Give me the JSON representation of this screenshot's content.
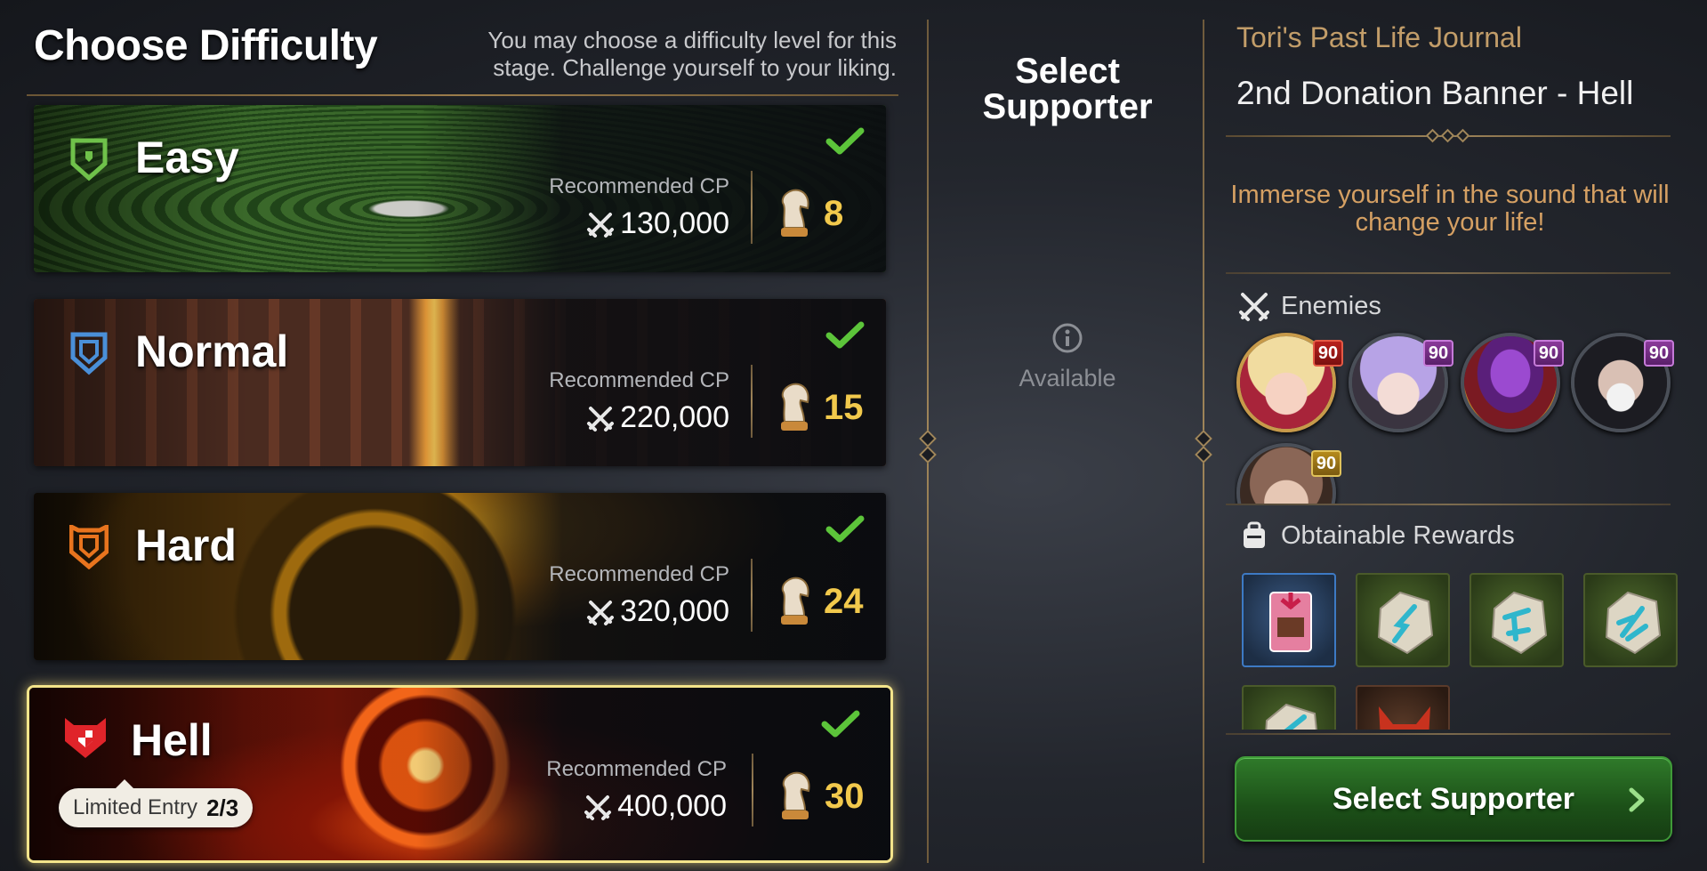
{
  "left": {
    "title": "Choose Difficulty",
    "description": "You may choose a difficulty level for this stage. Challenge yourself to your liking.",
    "difficulties": [
      {
        "name": "Easy",
        "rec_label": "Recommended CP",
        "cp": "130,000",
        "stamina": "8",
        "completed": true,
        "icon_color": "#6fc14a"
      },
      {
        "name": "Normal",
        "rec_label": "Recommended CP",
        "cp": "220,000",
        "stamina": "15",
        "completed": true,
        "icon_color": "#4a8fd8"
      },
      {
        "name": "Hard",
        "rec_label": "Recommended CP",
        "cp": "320,000",
        "stamina": "24",
        "completed": true,
        "icon_color": "#e8741e"
      },
      {
        "name": "Hell",
        "rec_label": "Recommended CP",
        "cp": "400,000",
        "stamina": "30",
        "completed": true,
        "icon_color": "#e0242a",
        "selected": true
      }
    ],
    "limited_entry": {
      "label": "Limited Entry",
      "count": "2/3"
    }
  },
  "middle": {
    "title_line1": "Select",
    "title_line2": "Supporter",
    "status": "Available"
  },
  "right": {
    "journal_title": "Tori's Past Life Journal",
    "stage_name": "2nd Donation Banner - Hell",
    "tagline": "Immerse yourself in the sound that will change your life!",
    "enemies_label": "Enemies",
    "enemies": [
      {
        "level": "90",
        "badge": "red"
      },
      {
        "level": "90",
        "badge": "purple"
      },
      {
        "level": "90",
        "badge": "purple"
      },
      {
        "level": "90",
        "badge": "purple"
      },
      {
        "level": "90",
        "badge": "gold"
      }
    ],
    "rewards_label": "Obtainable Rewards",
    "select_button": "Select Supporter"
  },
  "colors": {
    "accent_gold": "#c29d69",
    "stamina_yellow": "#f2c94c",
    "button_green": "#1c5018",
    "check_green": "#5cc43a"
  }
}
